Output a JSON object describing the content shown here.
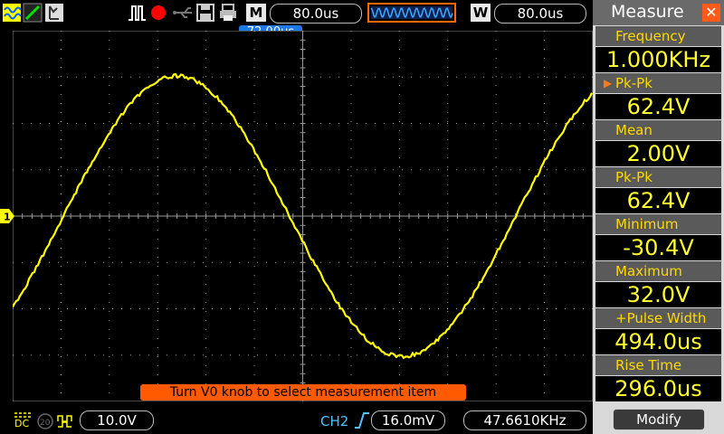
{
  "top_bar": {
    "horizontal_mode": "M",
    "horizontal_value": "80.0us",
    "window_mode": "W",
    "window_value": "80.0us",
    "time_marker": "72.00us",
    "icons": [
      "waveform-icon",
      "slope-icon",
      "scope-icon",
      "pulse-icon",
      "record-icon",
      "usb-icon",
      "save-icon",
      "print-icon"
    ]
  },
  "waveform": {
    "channel_marker": "1",
    "color": "#ffff00",
    "grid_color": "#9a9a9a"
  },
  "hint": {
    "text": "Turn V0 knob to select measurement item"
  },
  "bottom_bar": {
    "ch1_coupling": "DC",
    "ch1_scale": "10.0V",
    "ch2_label": "CH2",
    "ch2_value": "16.0mV",
    "frequency": "47.6610KHz"
  },
  "measure": {
    "title": "Measure",
    "items": [
      {
        "label": "Frequency",
        "value": "1.000KHz"
      },
      {
        "label": "Pk-Pk",
        "value": "62.4V",
        "selected": true
      },
      {
        "label": "Mean",
        "value": "2.00V"
      },
      {
        "label": "Pk-Pk",
        "value": "62.4V"
      },
      {
        "label": "Minimum",
        "value": "-30.4V"
      },
      {
        "label": "Maximum",
        "value": "32.0V"
      },
      {
        "label": "+Pulse Width",
        "value": "494.0us"
      },
      {
        "label": "Rise Time",
        "value": "296.0us"
      }
    ],
    "modify_label": "Modify",
    "accent": "#ffff30"
  }
}
